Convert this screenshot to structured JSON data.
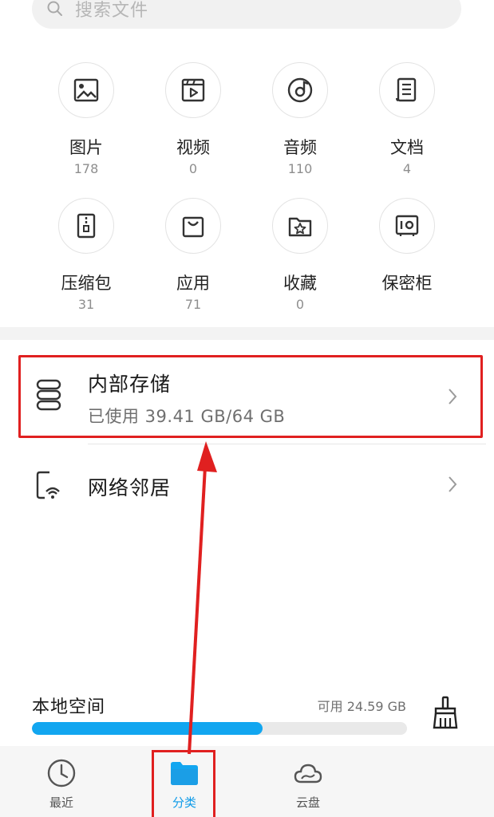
{
  "search": {
    "placeholder": "搜索文件"
  },
  "categories": [
    {
      "label": "图片",
      "count": "178",
      "icon": "image-icon"
    },
    {
      "label": "视频",
      "count": "0",
      "icon": "video-icon"
    },
    {
      "label": "音频",
      "count": "110",
      "icon": "audio-icon"
    },
    {
      "label": "文档",
      "count": "4",
      "icon": "document-icon"
    },
    {
      "label": "压缩包",
      "count": "31",
      "icon": "zip-icon"
    },
    {
      "label": "应用",
      "count": "71",
      "icon": "app-bag-icon"
    },
    {
      "label": "收藏",
      "count": "0",
      "icon": "star-folder-icon"
    },
    {
      "label": "保密柜",
      "count": "",
      "icon": "safe-icon"
    }
  ],
  "internal_storage": {
    "title": "内部存储",
    "subtitle": "已使用 39.41 GB/64 GB",
    "icon": "storage-stack-icon"
  },
  "network": {
    "title": "网络邻居",
    "icon": "phone-wifi-icon"
  },
  "local_space": {
    "title": "本地空间",
    "available": "可用 24.59 GB",
    "used_fraction": 0.615,
    "clean_icon": "broom-icon"
  },
  "nav": [
    {
      "label": "最近",
      "icon": "clock-icon",
      "active": false
    },
    {
      "label": "分类",
      "icon": "folder-icon",
      "active": true
    },
    {
      "label": "云盘",
      "icon": "cloud-icon",
      "active": false
    }
  ],
  "colors": {
    "accent": "#12a6f0",
    "annotation": "#e02020"
  }
}
